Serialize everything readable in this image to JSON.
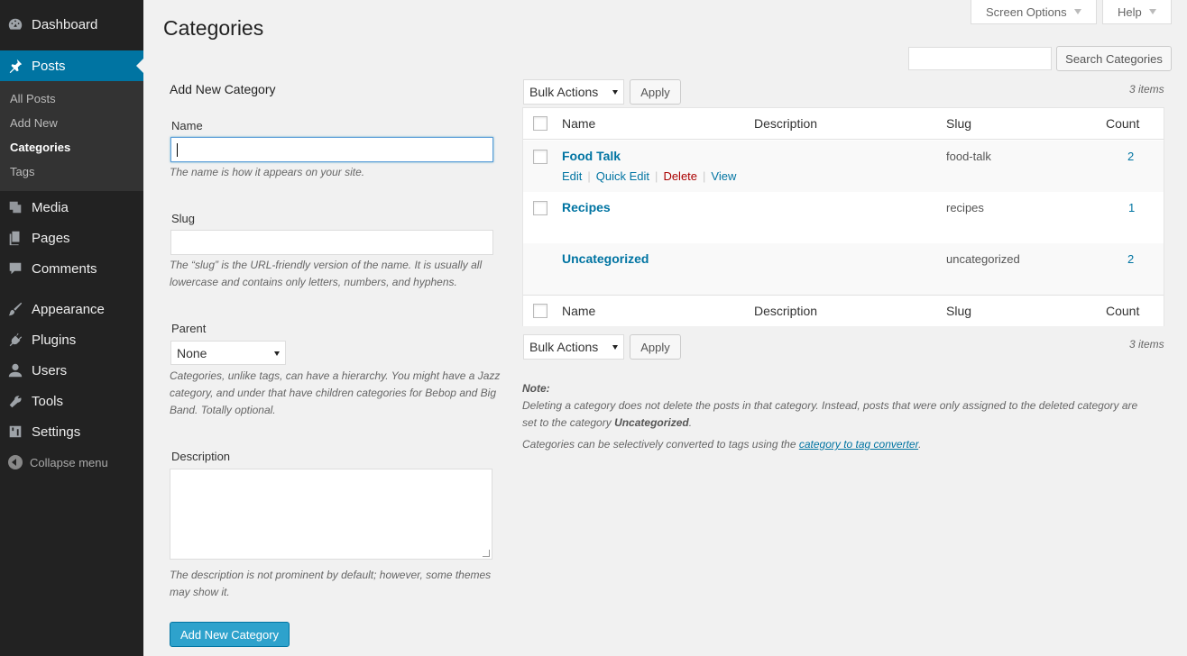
{
  "sidebar": {
    "dashboard": "Dashboard",
    "posts": "Posts",
    "posts_sub": [
      "All Posts",
      "Add New",
      "Categories",
      "Tags"
    ],
    "media": "Media",
    "pages": "Pages",
    "comments": "Comments",
    "appearance": "Appearance",
    "plugins": "Plugins",
    "users": "Users",
    "tools": "Tools",
    "settings": "Settings",
    "collapse": "Collapse menu"
  },
  "top": {
    "screen_options": "Screen Options",
    "help": "Help"
  },
  "page_title": "Categories",
  "search": {
    "value": "",
    "button": "Search Categories"
  },
  "form": {
    "title": "Add New Category",
    "name_label": "Name",
    "name_value": "",
    "name_help": "The name is how it appears on your site.",
    "slug_label": "Slug",
    "slug_value": "",
    "slug_help_1": "The “slug” is the URL-friendly version of the name. It is usually all",
    "slug_help_2": "lowercase and contains only letters, numbers, and hyphens.",
    "parent_label": "Parent",
    "parent_value": "None",
    "parent_help_1": "Categories, unlike tags, can have a hierarchy. You might have a Jazz",
    "parent_help_2": "category, and under that have children categories for Bebop and Big",
    "parent_help_3": "Band. Totally optional.",
    "description_label": "Description",
    "description_help_1": "The description is not prominent by default; however, some themes",
    "description_help_2": "may show it.",
    "submit": "Add New Category"
  },
  "bulk": {
    "select": "Bulk Actions",
    "apply": "Apply",
    "items": "3 items"
  },
  "table": {
    "columns": [
      "Name",
      "Description",
      "Slug",
      "Count"
    ],
    "rows": [
      {
        "name": "Food Talk",
        "slug": "food-talk",
        "count": "2"
      },
      {
        "name": "Recipes",
        "slug": "recipes",
        "count": "1"
      },
      {
        "name": "Uncategorized",
        "slug": "uncategorized",
        "count": "2"
      }
    ],
    "row_actions": [
      "Edit",
      "Quick Edit",
      "Delete",
      "View"
    ]
  },
  "notes": {
    "note_label": "Note:",
    "line1": "Deleting a category does not delete the posts in that category. Instead, posts that were only assigned to the deleted category are",
    "line2_prefix": "set to the category ",
    "line2_bold": "Uncategorized",
    "line2_suffix": ".",
    "line3_prefix": "Categories can be selectively converted to tags using the ",
    "line3_link": "category to tag converter",
    "line3_suffix": "."
  }
}
